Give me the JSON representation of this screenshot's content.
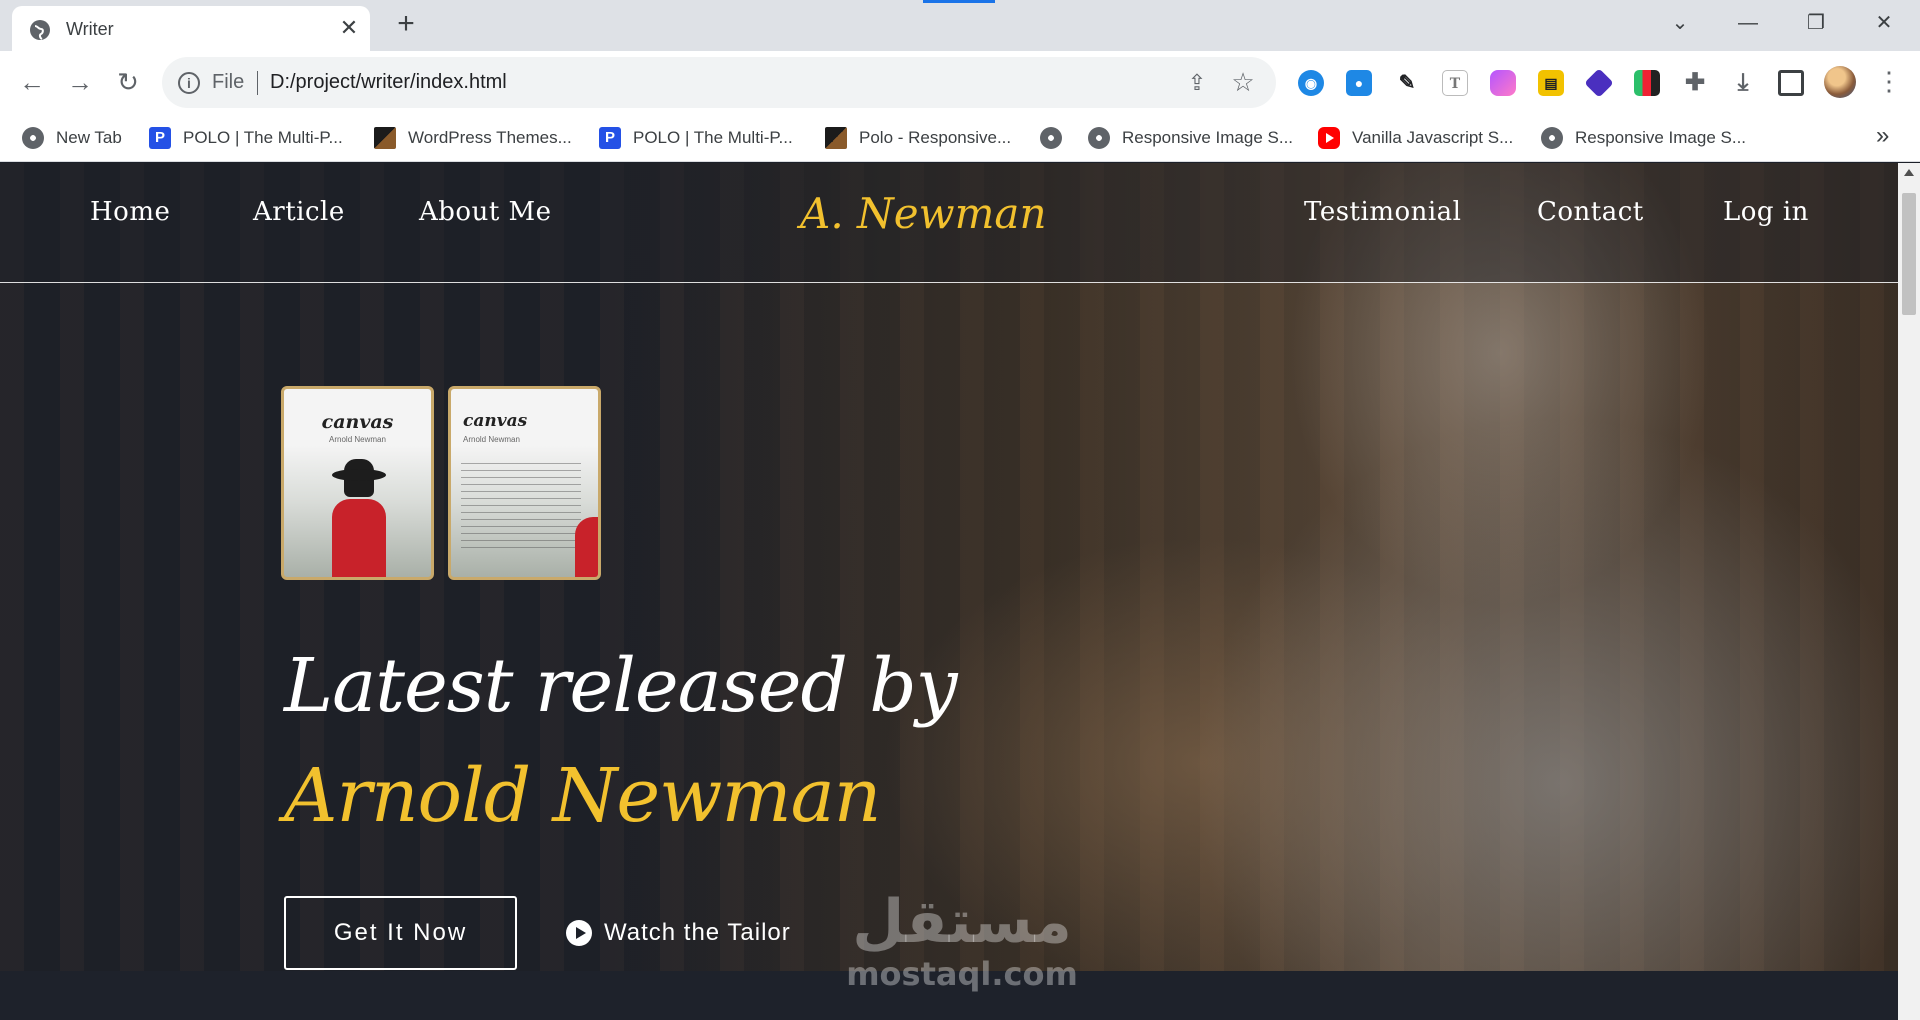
{
  "browser": {
    "tab": {
      "title": "Writer"
    },
    "address": {
      "scheme": "File",
      "url": "D:/project/writer/index.html"
    },
    "bookmarks": [
      {
        "label": "New Tab",
        "icon": "globe"
      },
      {
        "label": "POLO | The Multi-P...",
        "icon": "polo"
      },
      {
        "label": "WordPress Themes...",
        "icon": "wordpress"
      },
      {
        "label": "POLO | The Multi-P...",
        "icon": "polo"
      },
      {
        "label": "Polo - Responsive...",
        "icon": "wordpress"
      },
      {
        "label": "",
        "icon": "globe"
      },
      {
        "label": "Responsive Image S...",
        "icon": "globe"
      },
      {
        "label": "Vanilla Javascript S...",
        "icon": "youtube"
      },
      {
        "label": "Responsive Image S...",
        "icon": "globe"
      }
    ],
    "more_bookmarks": "»"
  },
  "site": {
    "nav": {
      "left": [
        "Home",
        "Article",
        "About Me"
      ],
      "brand": "A. Newman",
      "right": [
        "Testimonial",
        "Contact",
        "Log in"
      ]
    },
    "covers": [
      {
        "title": "canvas",
        "author": "Arnold Newman"
      },
      {
        "title": "canvas",
        "author": "Arnold Newman"
      }
    ],
    "headline": {
      "line1": "Latest released by",
      "line2": "Arnold Newman"
    },
    "cta": {
      "primary": "Get It Now",
      "secondary": "Watch the Tailor"
    },
    "colors": {
      "accent": "#f2c12e",
      "dark": "#1c2029",
      "cover_border": "#c9a96a"
    }
  },
  "watermark": {
    "arabic": "مستقل",
    "latin": "mostaql.com"
  }
}
